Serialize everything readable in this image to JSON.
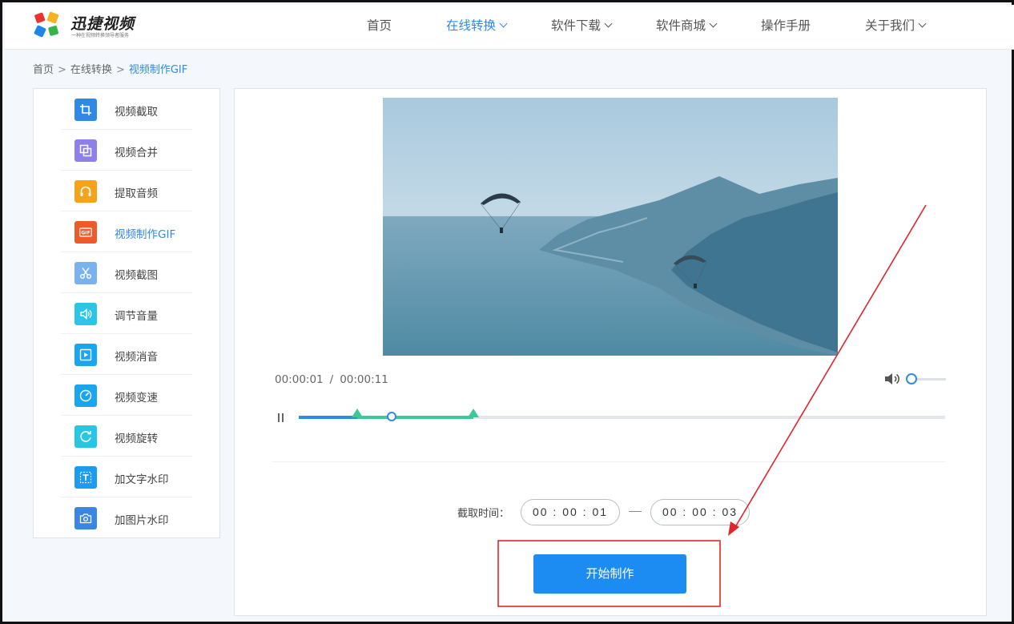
{
  "brand": {
    "name": "迅捷视频",
    "tagline": "一种在视频转换领导者服务"
  },
  "nav": {
    "items": [
      {
        "label": "首页",
        "dropdown": false,
        "active": false
      },
      {
        "label": "在线转换",
        "dropdown": true,
        "active": true
      },
      {
        "label": "软件下载",
        "dropdown": true,
        "active": false
      },
      {
        "label": "软件商城",
        "dropdown": true,
        "active": false
      },
      {
        "label": "操作手册",
        "dropdown": false,
        "active": false
      },
      {
        "label": "关于我们",
        "dropdown": true,
        "active": false
      }
    ]
  },
  "breadcrumb": {
    "items": [
      "首页",
      "在线转换"
    ],
    "separator": ">",
    "current": "视频制作GIF"
  },
  "sidebar": {
    "items": [
      {
        "label": "视频截取",
        "icon": "crop-icon",
        "color": "#2f8ae5",
        "active": false
      },
      {
        "label": "视频合并",
        "icon": "merge-icon",
        "color": "#8e80ec",
        "active": false
      },
      {
        "label": "提取音频",
        "icon": "headphones-icon",
        "color": "#f7a21b",
        "active": false
      },
      {
        "label": "视频制作GIF",
        "icon": "gif-icon",
        "color": "#ef5a2a",
        "active": true
      },
      {
        "label": "视频截图",
        "icon": "scissors-icon",
        "color": "#7ab2f0",
        "active": false
      },
      {
        "label": "调节音量",
        "icon": "volume-icon",
        "color": "#2cc5e8",
        "active": false
      },
      {
        "label": "视频消音",
        "icon": "play-box-icon",
        "color": "#1aa5ef",
        "active": false
      },
      {
        "label": "视频变速",
        "icon": "speedometer-icon",
        "color": "#1aa5ef",
        "active": false
      },
      {
        "label": "视频旋转",
        "icon": "rotate-icon",
        "color": "#26c7e6",
        "active": false
      },
      {
        "label": "加文字水印",
        "icon": "text-watermark-icon",
        "color": "#1d9bef",
        "active": false
      },
      {
        "label": "加图片水印",
        "icon": "image-watermark-icon",
        "color": "#3b87e0",
        "active": false
      }
    ]
  },
  "player": {
    "current_time": "00:00:01",
    "separator": "/",
    "duration": "00:00:11",
    "progress_fraction": 0.09,
    "range_start_fraction": 0.09,
    "range_end_fraction": 0.27,
    "volume_fraction": 0.0
  },
  "cut": {
    "label": "截取时间：",
    "start": "00 : 00 : 01",
    "end": "00 : 00 : 03"
  },
  "action": {
    "start_label": "开始制作"
  },
  "colors": {
    "accent": "#1d8cf2",
    "range": "#3fc69a",
    "annotation": "#e0262a"
  }
}
